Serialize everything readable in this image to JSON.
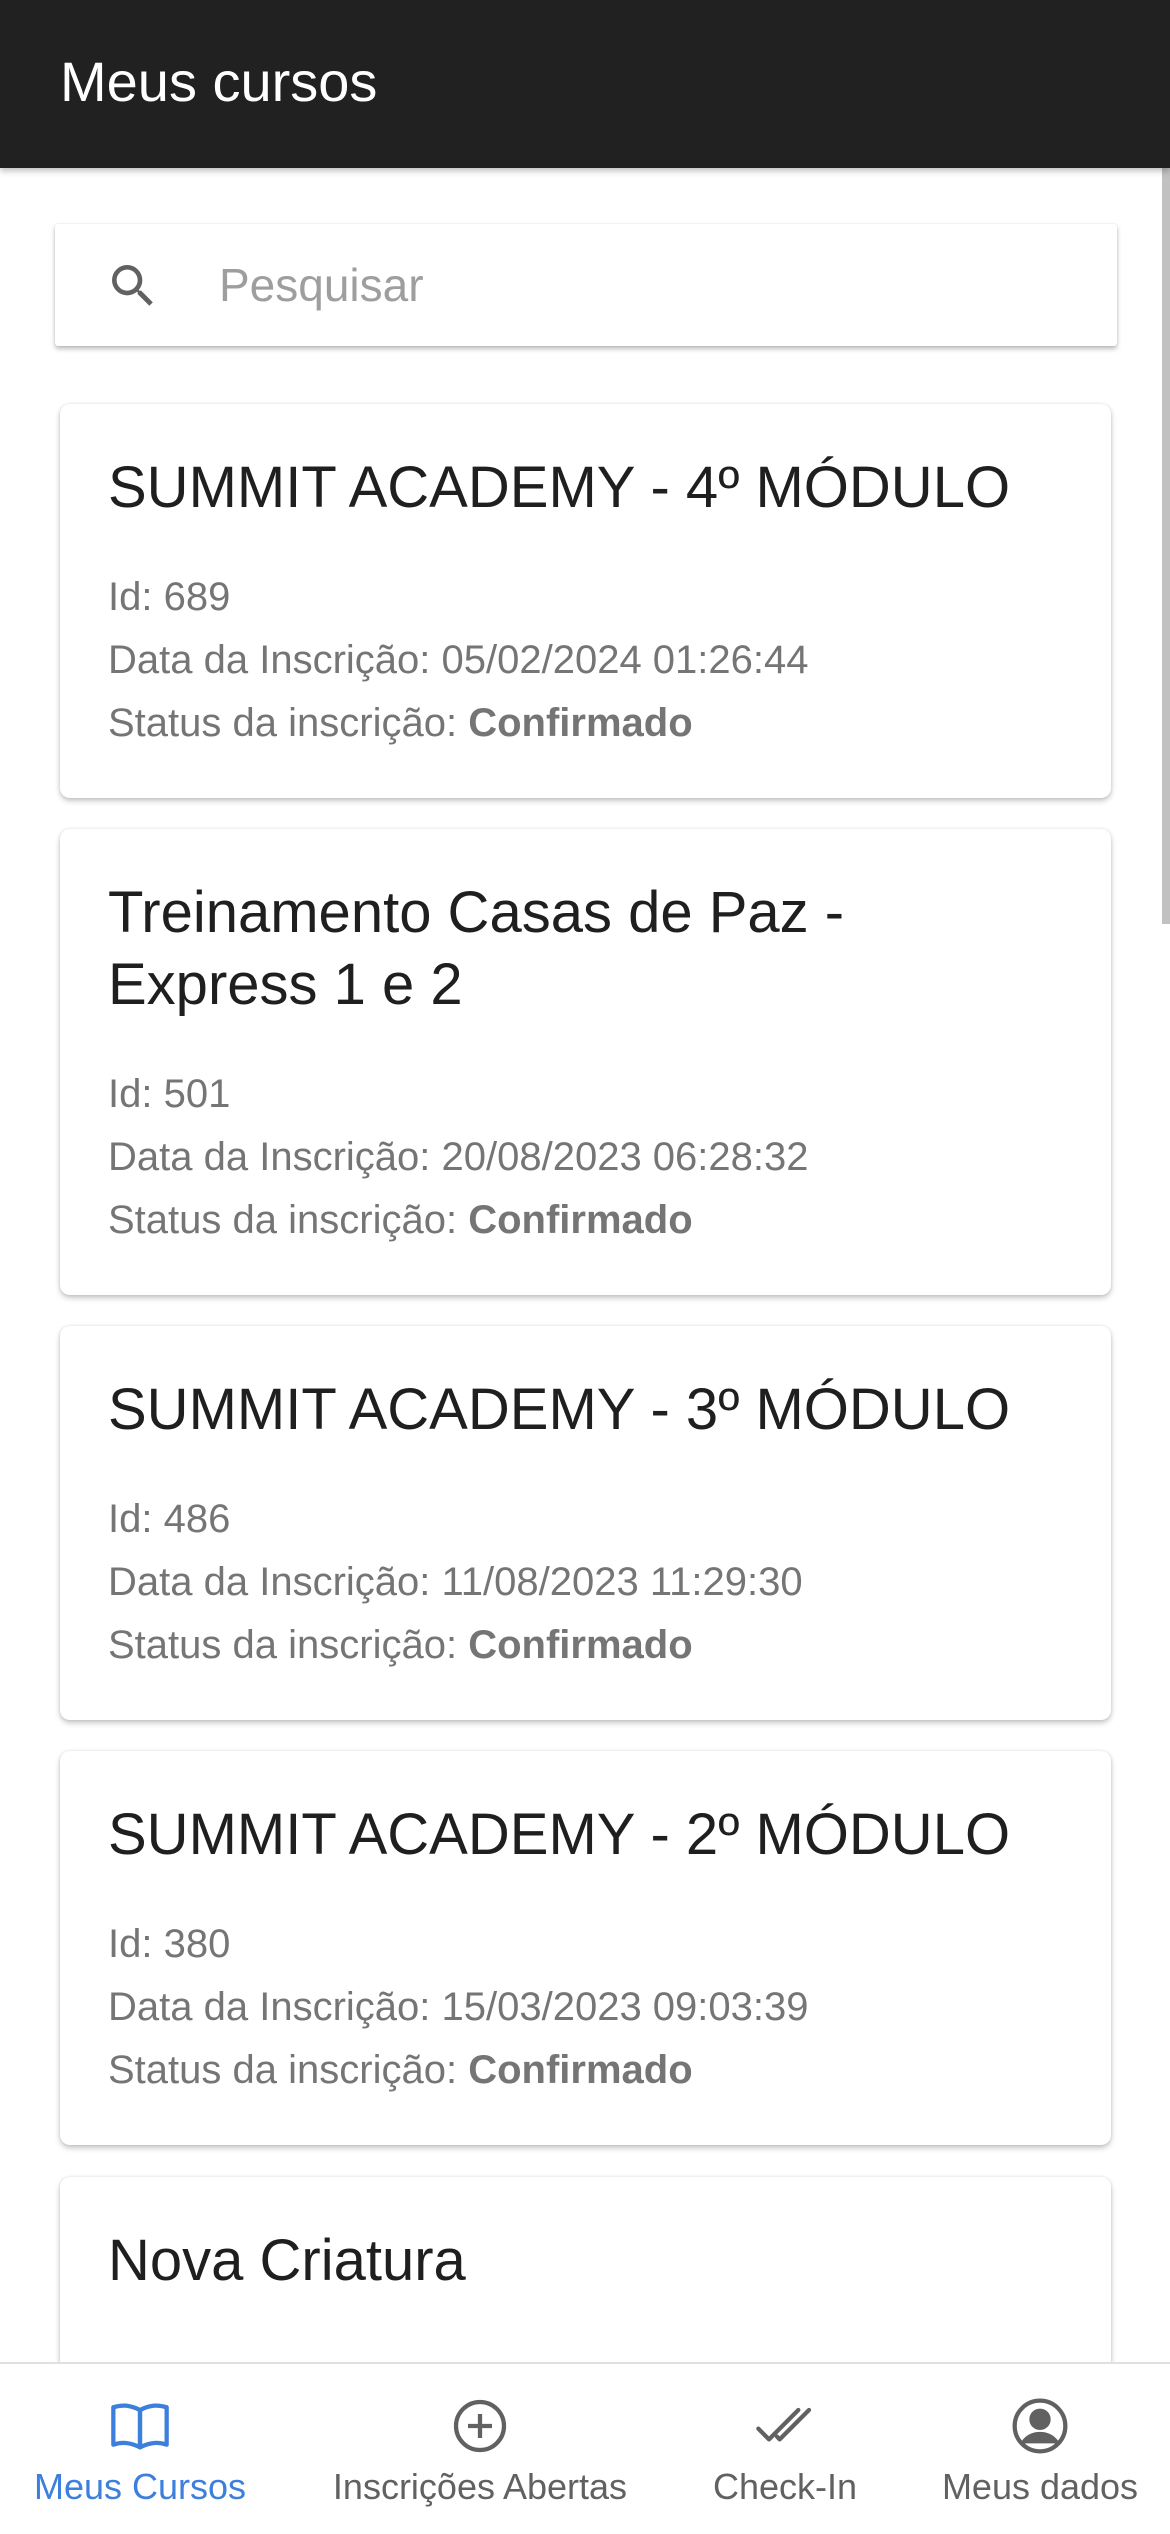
{
  "app_bar": {
    "title": "Meus cursos"
  },
  "search": {
    "placeholder": "Pesquisar",
    "value": ""
  },
  "labels": {
    "id": "Id: ",
    "date": "Data da Inscrição: ",
    "status": "Status da inscrição: "
  },
  "courses": [
    {
      "title": "SUMMIT ACADEMY - 4º MÓDULO",
      "id": "689",
      "date": "05/02/2024 01:26:44",
      "status": "Confirmado"
    },
    {
      "title": "Treinamento Casas de Paz - Express 1 e 2",
      "id": "501",
      "date": "20/08/2023 06:28:32",
      "status": "Confirmado"
    },
    {
      "title": "SUMMIT ACADEMY - 3º MÓDULO",
      "id": "486",
      "date": "11/08/2023 11:29:30",
      "status": "Confirmado"
    },
    {
      "title": "SUMMIT ACADEMY - 2º MÓDULO",
      "id": "380",
      "date": "15/03/2023 09:03:39",
      "status": "Confirmado"
    },
    {
      "title": "Nova Criatura"
    }
  ],
  "bottom_nav": {
    "items": [
      {
        "label": "Meus Cursos",
        "icon": "book-open-icon",
        "active": true
      },
      {
        "label": "Inscrições Abertas",
        "icon": "plus-circle-icon",
        "active": false
      },
      {
        "label": "Check-In",
        "icon": "double-check-icon",
        "active": false
      },
      {
        "label": "Meus dados",
        "icon": "account-circle-icon",
        "active": false
      }
    ]
  },
  "colors": {
    "app_bar": "#212121",
    "active_nav": "#3d7fdc",
    "inactive_nav": "#616161",
    "meta_text": "#757575"
  }
}
